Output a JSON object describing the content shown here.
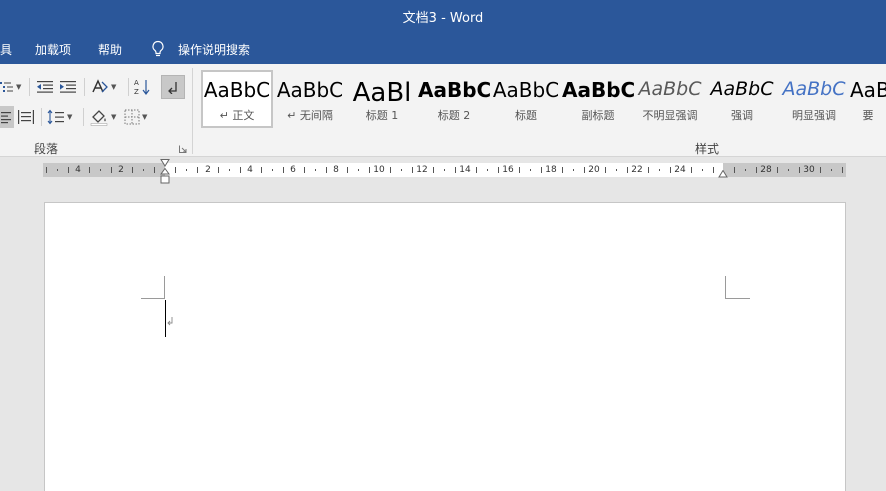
{
  "window": {
    "title": "文档3  -  Word"
  },
  "menu": {
    "tools_partial": "具",
    "addins": "加载项",
    "help": "帮助",
    "tell_me": "操作说明搜索"
  },
  "ribbon": {
    "paragraph_group": "段落",
    "styles_group": "样式",
    "styles": [
      {
        "sample": "AaBbC",
        "name": "↵ 正文",
        "weight": "normal",
        "color": "#000000",
        "italic": false,
        "selected": true
      },
      {
        "sample": "AaBbC",
        "name": "↵ 无间隔",
        "weight": "normal",
        "color": "#000000",
        "italic": false,
        "selected": false
      },
      {
        "sample": "AaBl",
        "name": "标题 1",
        "weight": "normal",
        "color": "#000000",
        "italic": false,
        "selected": false
      },
      {
        "sample": "AaBbC",
        "name": "标题 2",
        "weight": "bold",
        "color": "#000000",
        "italic": false,
        "selected": false
      },
      {
        "sample": "AaBbC",
        "name": "标题",
        "weight": "normal",
        "color": "#000000",
        "italic": false,
        "selected": false
      },
      {
        "sample": "AaBbC",
        "name": "副标题",
        "weight": "bold",
        "color": "#000000",
        "italic": false,
        "selected": false
      },
      {
        "sample": "AaBbC",
        "name": "不明显强调",
        "weight": "normal",
        "color": "#595959",
        "italic": true,
        "selected": false
      },
      {
        "sample": "AaBbC",
        "name": "强调",
        "weight": "normal",
        "color": "#000000",
        "italic": true,
        "selected": false
      },
      {
        "sample": "AaBbC",
        "name": "明显强调",
        "weight": "normal",
        "color": "#4472c4",
        "italic": true,
        "selected": false
      },
      {
        "sample": "AaB",
        "name": "要",
        "weight": "normal",
        "color": "#000000",
        "italic": false,
        "selected": false
      }
    ]
  },
  "ruler": {
    "labels": [
      "4",
      "2",
      "2",
      "4",
      "6",
      "8",
      "10",
      "12",
      "14",
      "16",
      "18",
      "20",
      "22",
      "24",
      "28",
      "30"
    ]
  },
  "colors": {
    "title_bar": "#2b579a",
    "accent_style": "#4472c4"
  }
}
